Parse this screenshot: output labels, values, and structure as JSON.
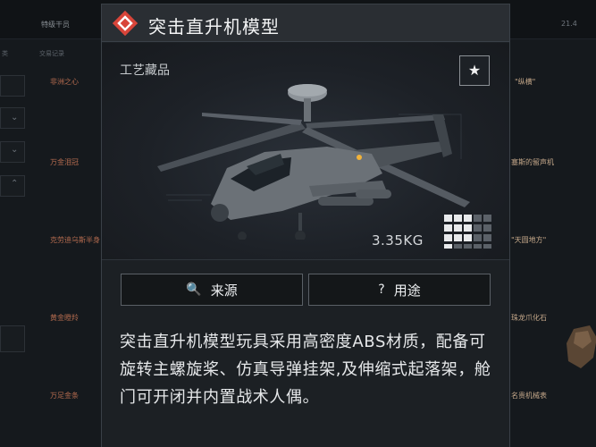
{
  "background": {
    "tabs": [
      "特级干员"
    ],
    "top_right": "21.4",
    "sub_left": "类",
    "sub_mid": "交易记录",
    "left_items": [
      "非洲之心",
      "万金泪冠",
      "克劳迪乌斯半身",
      "黄金瞪羚",
      "万足金条"
    ],
    "right_items": [
      "\"纵横\"",
      "塞斯的留声机",
      "\"天圆地方\"",
      "珠龙爪化石",
      "名贵机械表"
    ]
  },
  "item": {
    "title": "突击直升机模型",
    "category": "工艺藏品",
    "weight": "3.35KG",
    "rarity_color": "#d8453a",
    "grid_size": {
      "cols": 5,
      "rows": 4,
      "filled": 10
    }
  },
  "icons": {
    "rarity": "diamond-rarity-icon",
    "favorite": "star-icon",
    "source": "search-icon",
    "use": "question-icon"
  },
  "buttons": {
    "favorite_glyph": "★",
    "source_icon_glyph": "🔍",
    "source_label": "来源",
    "use_icon_glyph": "?",
    "use_label": "用途"
  },
  "description": "突击直升机模型玩具采用高密度ABS材质，配备可旋转主螺旋桨、仿真导弹挂架,及伸缩式起落架，舱门可开闭并内置战术人偶。"
}
